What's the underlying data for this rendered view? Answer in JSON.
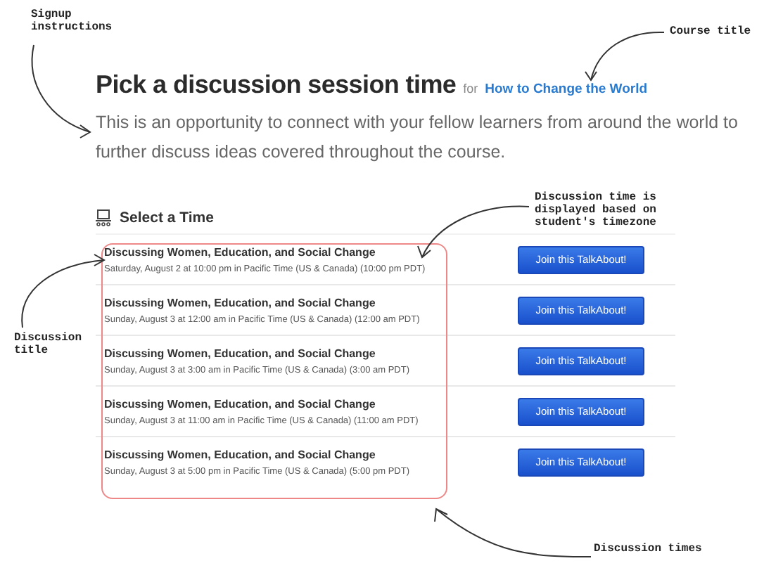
{
  "heading": {
    "title": "Pick a discussion session time",
    "for_label": "for",
    "course_link": "How to Change the World"
  },
  "description": "This is an opportunity to connect with your fellow learners from around the world to further discuss ideas covered throughout the course.",
  "section_title": "Select a Time",
  "sessions": [
    {
      "title": "Discussing Women, Education, and Social Change",
      "time": "Saturday, August 2 at 10:00 pm in Pacific Time (US & Canada) (10:00 pm PDT)",
      "button": "Join this TalkAbout!"
    },
    {
      "title": "Discussing Women, Education, and Social Change",
      "time": "Sunday, August 3 at 12:00 am in Pacific Time (US & Canada) (12:00 am PDT)",
      "button": "Join this TalkAbout!"
    },
    {
      "title": "Discussing Women, Education, and Social Change",
      "time": "Sunday, August 3 at 3:00 am in Pacific Time (US & Canada) (3:00 am PDT)",
      "button": "Join this TalkAbout!"
    },
    {
      "title": "Discussing Women, Education, and Social Change",
      "time": "Sunday, August 3 at 11:00 am in Pacific Time (US & Canada) (11:00 am PDT)",
      "button": "Join this TalkAbout!"
    },
    {
      "title": "Discussing Women, Education, and Social Change",
      "time": "Sunday, August 3 at 5:00 pm in Pacific Time (US & Canada) (5:00 pm PDT)",
      "button": "Join this TalkAbout!"
    }
  ],
  "annotations": [
    {
      "text": "Signup instructions"
    },
    {
      "text": "Course title"
    },
    {
      "text": "Discussion time is displayed based on student's timezone"
    },
    {
      "text": "Discussion title"
    },
    {
      "text": "Discussion times"
    }
  ]
}
